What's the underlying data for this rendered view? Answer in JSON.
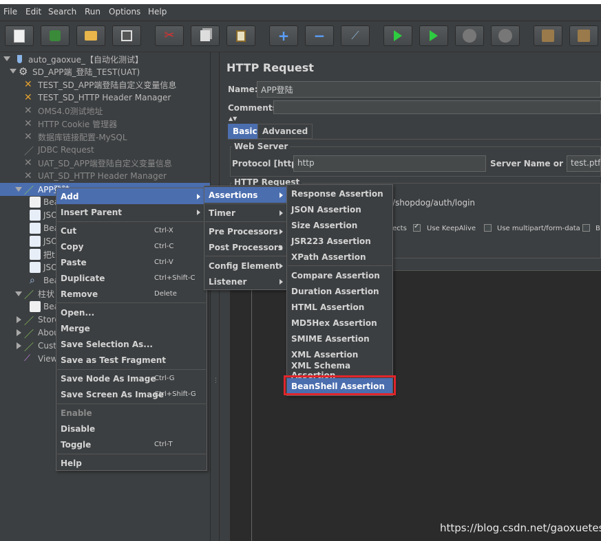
{
  "menubar": {
    "items": [
      "File",
      "Edit",
      "Search",
      "Run",
      "Options",
      "Help"
    ]
  },
  "toolbar": {
    "buttons": [
      "new-icon",
      "templates-icon",
      "open-icon",
      "save-icon",
      "cut-icon",
      "copy-icon",
      "paste-icon",
      "expand-icon",
      "collapse-icon",
      "toggle-icon",
      "start-icon",
      "start-no-pause-icon",
      "stop-icon",
      "shutdown-icon",
      "clear-icon",
      "clear-all-icon"
    ]
  },
  "tree": {
    "root": "auto_gaoxue_【自动化测试】",
    "thread_group": "SD_APP端_登陆_TEST(UAT)",
    "items": [
      "TEST_SD_APP端登陆自定义变量信息",
      "TEST_SD_HTTP Header Manager",
      "OMS4.0测试地址",
      "HTTP Cookie 管理器",
      "数据库链接配置-MySQL",
      "JDBC Request",
      "UAT_SD_APP端登陆自定义变量信息",
      "UAT_SD_HTTP Header Manager"
    ],
    "selected": "APP登陆",
    "children": [
      "Bea",
      "JSO",
      "Bea",
      "JSO",
      "把t",
      "JSO",
      "Bea"
    ],
    "group2": "柱状",
    "group2_child": "Bea",
    "more": [
      "Store",
      "Abou",
      "Cust",
      "View"
    ]
  },
  "panel": {
    "title": "HTTP Request",
    "name_label": "Name:",
    "name_value": "APP登陆",
    "comments_label": "Comments:",
    "tabs": [
      "Basic",
      "Advanced"
    ],
    "web_server_title": "Web Server",
    "protocol_label": "Protocol [http]:",
    "protocol_value": "http",
    "server_label": "Server Name or IP:",
    "server_value": "test.ptfff",
    "http_request_title": "HTTP Request",
    "path_value": "/shopdog/auth/login",
    "opt_redirects": "ects",
    "opt_keepalive": "Use KeepAlive",
    "opt_multipart": "Use multipart/form-data",
    "opt_b": "B"
  },
  "context_menu": {
    "items": [
      {
        "label": "Add",
        "shortcut": ""
      },
      {
        "label": "Insert Parent",
        "shortcut": ""
      },
      {
        "label": "Cut",
        "shortcut": "Ctrl-X"
      },
      {
        "label": "Copy",
        "shortcut": "Ctrl-C"
      },
      {
        "label": "Paste",
        "shortcut": "Ctrl-V"
      },
      {
        "label": "Duplicate",
        "shortcut": "Ctrl+Shift-C"
      },
      {
        "label": "Remove",
        "shortcut": "Delete"
      },
      {
        "label": "Open...",
        "shortcut": ""
      },
      {
        "label": "Merge",
        "shortcut": ""
      },
      {
        "label": "Save Selection As...",
        "shortcut": ""
      },
      {
        "label": "Save as Test Fragment",
        "shortcut": ""
      },
      {
        "label": "Save Node As Image",
        "shortcut": "Ctrl-G"
      },
      {
        "label": "Save Screen As Image",
        "shortcut": "Ctrl+Shift-G"
      },
      {
        "label": "Enable",
        "shortcut": ""
      },
      {
        "label": "Disable",
        "shortcut": ""
      },
      {
        "label": "Toggle",
        "shortcut": "Ctrl-T"
      },
      {
        "label": "Help",
        "shortcut": ""
      }
    ]
  },
  "add_submenu": {
    "items": [
      "Assertions",
      "Timer",
      "Pre Processors",
      "Post Processors",
      "Config Element",
      "Listener"
    ]
  },
  "assertions_submenu": {
    "items": [
      "Response Assertion",
      "JSON Assertion",
      "Size Assertion",
      "JSR223 Assertion",
      "XPath Assertion",
      "Compare Assertion",
      "Duration Assertion",
      "HTML Assertion",
      "MD5Hex Assertion",
      "SMIME Assertion",
      "XML Assertion",
      "XML Schema Assertion",
      "BeanShell Assertion"
    ]
  },
  "watermark": "https://blog.csdn.net/gaoxuetest",
  "colors": {
    "background": "#3c3f41",
    "selection": "#4b6eaf",
    "highlight_box": "#e0252b"
  }
}
